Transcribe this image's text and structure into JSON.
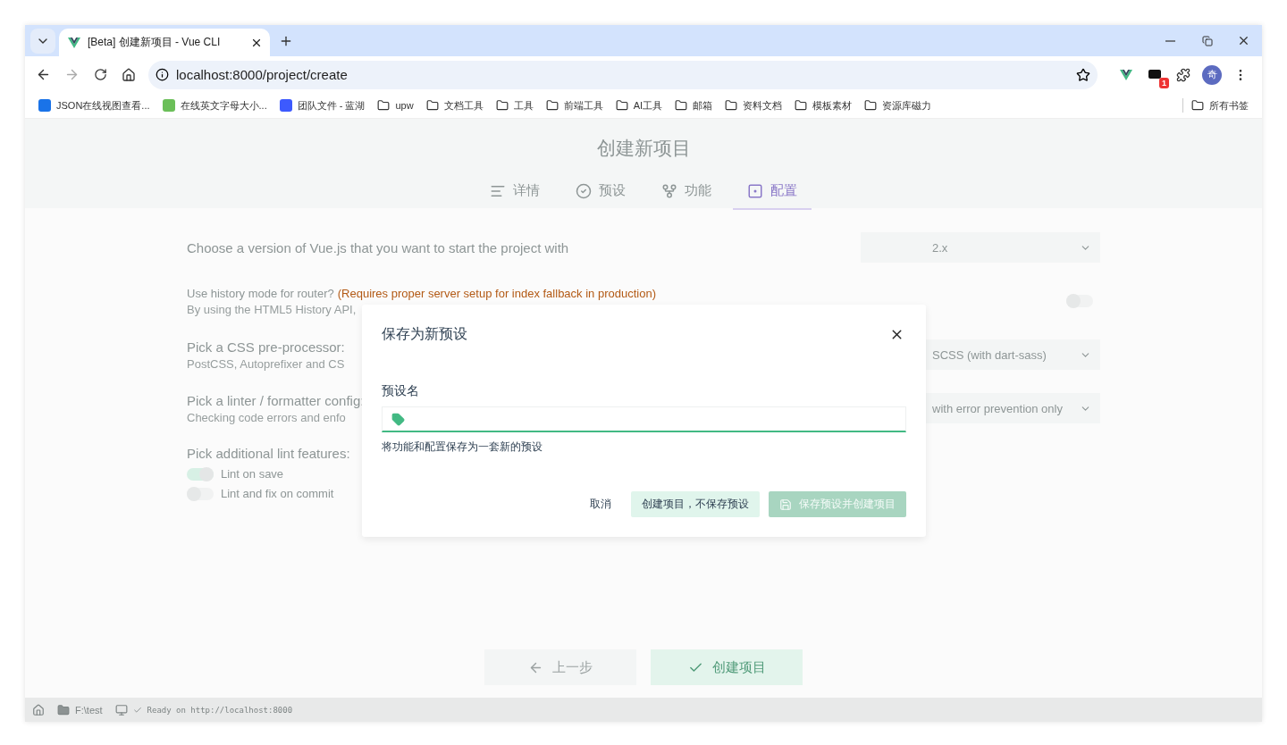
{
  "browser": {
    "tabs": [
      {
        "title": "[Beta] 创建新项目 - Vue CLI",
        "selected": true
      }
    ],
    "address": "localhost:8000/project/create",
    "extension_badge": "1",
    "avatar": "奇",
    "bookmarks": [
      {
        "label": "JSON在线视图查看...",
        "kind": "site",
        "color": "#1a73e8"
      },
      {
        "label": "在线英文字母大小...",
        "kind": "site",
        "color": "#6bbf59"
      },
      {
        "label": "团队文件 - 蓝湖",
        "kind": "site",
        "color": "#3d5afe"
      },
      {
        "label": "upw",
        "kind": "folder"
      },
      {
        "label": "文档工具",
        "kind": "folder"
      },
      {
        "label": "工具",
        "kind": "folder"
      },
      {
        "label": "前端工具",
        "kind": "folder"
      },
      {
        "label": "AI工具",
        "kind": "folder"
      },
      {
        "label": "邮箱",
        "kind": "folder"
      },
      {
        "label": "资料文档",
        "kind": "folder"
      },
      {
        "label": "模板素材",
        "kind": "folder"
      },
      {
        "label": "资源库磁力",
        "kind": "folder"
      }
    ],
    "all_bookmarks": "所有书签"
  },
  "page": {
    "title": "创建新项目",
    "steps": [
      {
        "label": "详情",
        "selected": false
      },
      {
        "label": "预设",
        "selected": false
      },
      {
        "label": "功能",
        "selected": false
      },
      {
        "label": "配置",
        "selected": true
      }
    ],
    "settings": [
      {
        "kind": "select",
        "label": "Choose a version of Vue.js that you want to start the project with",
        "value": "2.x"
      },
      {
        "kind": "toggle",
        "label": "Use history mode for router?",
        "warning": "(Requires proper server setup for index fallback in production)",
        "description": "By using the HTML5 History API,",
        "on": false
      },
      {
        "kind": "select",
        "label": "Pick a CSS pre-processor:",
        "description": "PostCSS, Autoprefixer and CS",
        "value": "SCSS (with dart-sass)"
      },
      {
        "kind": "select",
        "label": "Pick a linter / formatter config:",
        "description": "Checking code errors and enfo",
        "value": "with error prevention only"
      },
      {
        "kind": "toggles",
        "label": "Pick additional lint features:",
        "options": [
          {
            "label": "Lint on save",
            "on": true
          },
          {
            "label": "Lint and fix on commit",
            "on": false
          }
        ]
      }
    ],
    "footer_buttons": [
      {
        "label": "上一步",
        "kind": "back",
        "disabled": true
      },
      {
        "label": "创建项目",
        "kind": "create",
        "disabled": false
      }
    ]
  },
  "status_bar": [
    {
      "text": "F:\\test"
    },
    {
      "text": "Ready on http://localhost:8000"
    }
  ],
  "dialog": {
    "title": "保存为新预设",
    "field_label": "预设名",
    "help": "将功能和配置保存为一套新的预设",
    "buttons": [
      {
        "label": "取消",
        "kind": "flat",
        "disabled": false
      },
      {
        "label": "创建项目，不保存预设",
        "kind": "secondary",
        "disabled": false
      },
      {
        "label": "保存预设并创建项目",
        "kind": "primary",
        "disabled": true
      }
    ]
  }
}
